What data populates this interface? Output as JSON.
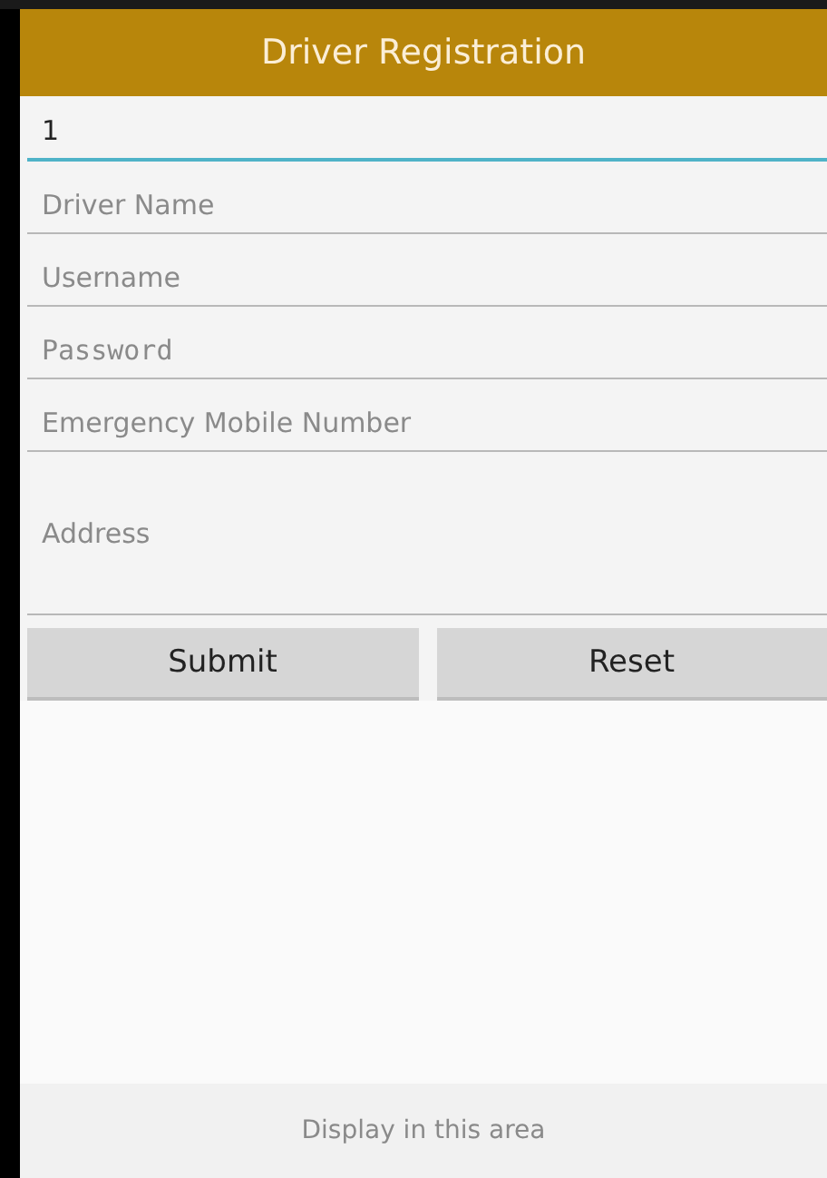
{
  "title": "Driver Registration",
  "fields": [
    {
      "kind": "text",
      "value": "1",
      "focused": true
    },
    {
      "kind": "text",
      "placeholder": "Driver Name",
      "focused": false
    },
    {
      "kind": "text",
      "placeholder": "Username",
      "focused": false
    },
    {
      "kind": "password",
      "placeholder": "Password",
      "focused": false
    },
    {
      "kind": "text",
      "placeholder": "Emergency Mobile Number",
      "focused": false
    },
    {
      "kind": "multiline",
      "placeholder": "Address",
      "focused": false
    }
  ],
  "buttons": [
    "Submit",
    "Reset"
  ],
  "footer": "Display in this area"
}
